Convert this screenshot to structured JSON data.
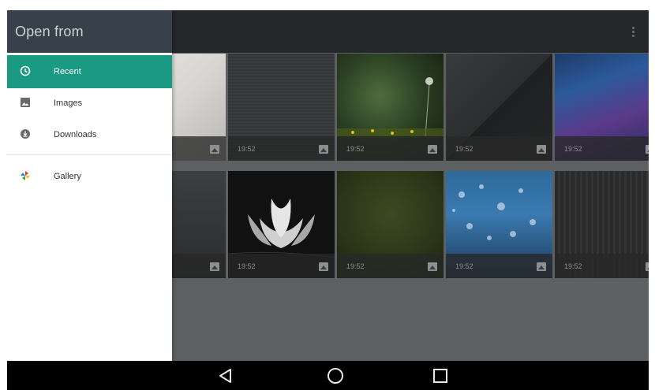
{
  "drawer": {
    "title": "Open from",
    "items": [
      {
        "label": "Recent",
        "icon": "clock-icon",
        "active": true
      },
      {
        "label": "Images",
        "icon": "image-icon",
        "active": false
      },
      {
        "label": "Downloads",
        "icon": "download-icon",
        "active": false
      },
      {
        "label": "Gallery",
        "icon": "gallery-pinwheel-icon",
        "active": false
      }
    ]
  },
  "toolbar": {
    "menu_icon": "overflow-menu-icon"
  },
  "files": [
    {
      "time": "",
      "icon": "image-icon"
    },
    {
      "time": "19:52",
      "icon": "image-icon"
    },
    {
      "time": "19:52",
      "icon": "image-icon"
    },
    {
      "time": "19:52",
      "icon": "image-icon"
    },
    {
      "time": "19:52",
      "icon": "image-icon"
    },
    {
      "time": "",
      "icon": "image-icon"
    },
    {
      "time": "19:52",
      "icon": "image-icon"
    },
    {
      "time": "19:52",
      "icon": "image-icon"
    },
    {
      "time": "19:52",
      "icon": "image-icon"
    },
    {
      "time": "19:52",
      "icon": "image-icon"
    }
  ],
  "navigation": {
    "back": "back-triangle-icon",
    "home": "home-circle-icon",
    "recents": "recents-square-icon"
  },
  "colors": {
    "accent": "#1a9a83",
    "drawer_header": "#38414b",
    "toolbar": "#25282a"
  }
}
